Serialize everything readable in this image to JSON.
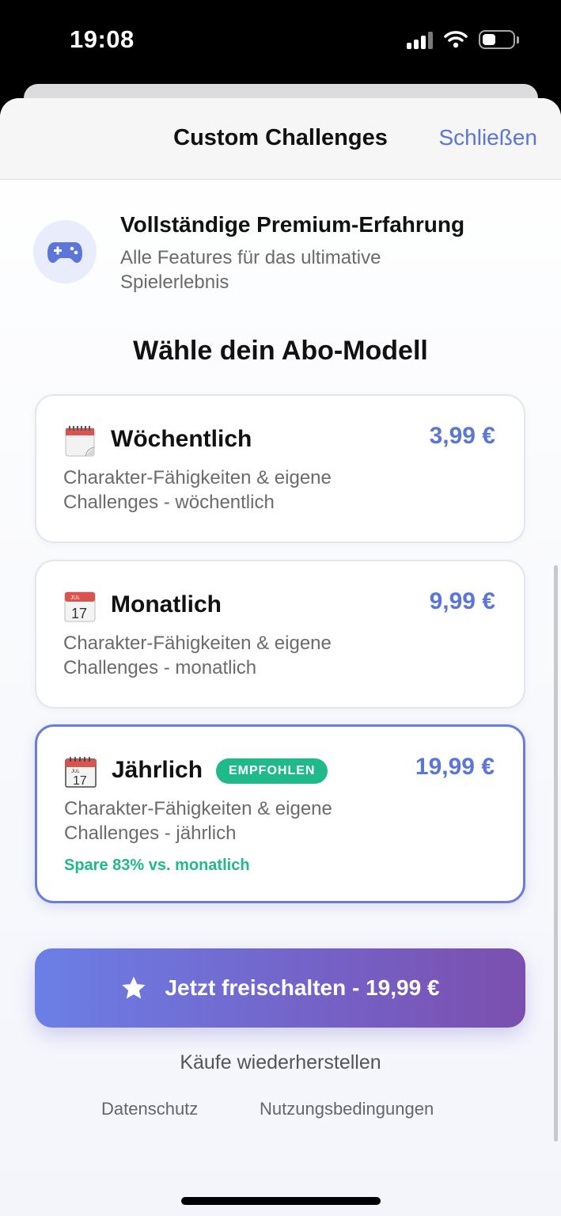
{
  "status_bar": {
    "time": "19:08",
    "icons": [
      "signal-icon",
      "wifi-icon",
      "battery-icon"
    ]
  },
  "sheet": {
    "title": "Custom Challenges",
    "close_label": "Schließen"
  },
  "feature": {
    "icon": "gamepad-icon",
    "title": "Vollständige Premium-Erfahrung",
    "description": "Alle Features für das ultimative Spielerlebnis"
  },
  "section_title": "Wähle dein Abo-Modell",
  "plans": [
    {
      "icon": "calendar-tearoff-icon",
      "name": "Wöchentlich",
      "price": "3,99 €",
      "description": "Charakter-Fähigkeiten & eigene Challenges - wöchentlich",
      "selected": false
    },
    {
      "icon": "calendar-icon",
      "icon_month": "JUL",
      "icon_day": "17",
      "name": "Monatlich",
      "price": "9,99 €",
      "description": "Charakter-Fähigkeiten & eigene Challenges - monatlich",
      "selected": false
    },
    {
      "icon": "spiral-calendar-icon",
      "icon_month": "JUL",
      "icon_day": "17",
      "name": "Jährlich",
      "badge": "EMPFOHLEN",
      "price": "19,99 €",
      "description": "Charakter-Fähigkeiten & eigene Challenges - jährlich",
      "savings": "Spare 83% vs. monatlich",
      "selected": true
    }
  ],
  "cta": {
    "icon": "star-icon",
    "label": "Jetzt freischalten - 19,99 €"
  },
  "restore_label": "Käufe wiederherstellen",
  "legal": {
    "privacy": "Datenschutz",
    "terms": "Nutzungsbedingungen"
  },
  "colors": {
    "accent": "#5b76d8",
    "green": "#1fb98a",
    "cta_start": "#6b7fe6",
    "cta_end": "#7b4fae"
  }
}
